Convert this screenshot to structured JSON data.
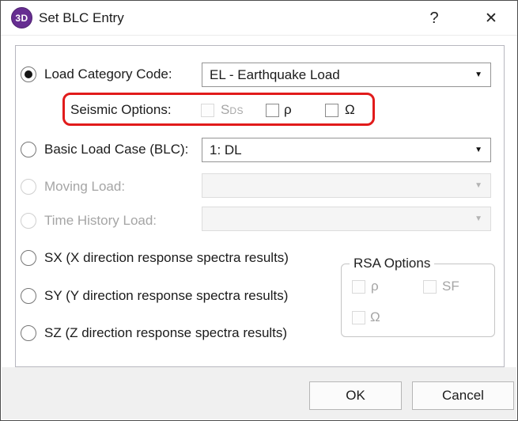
{
  "window": {
    "title": "Set BLC Entry",
    "icon": "3D",
    "help": "?",
    "close": "✕"
  },
  "colors": {
    "icon_purple": "#662d91",
    "highlight_red": "#e11b1b"
  },
  "load_category": {
    "label": "Load Category Code:",
    "value": "EL - Earthquake Load",
    "selected": true
  },
  "seismic": {
    "label": "Seismic Options:",
    "sds_main": "S",
    "sds_sub": "DS",
    "rho": "ρ",
    "omega": "Ω"
  },
  "basic_load_case": {
    "label": "Basic Load Case (BLC):",
    "value": "1: DL"
  },
  "moving_load": {
    "label": "Moving Load:",
    "value": ""
  },
  "time_history": {
    "label": "Time History Load:",
    "value": ""
  },
  "spectra": {
    "sx": "SX (X direction response spectra results)",
    "sy": "SY (Y direction response spectra results)",
    "sz": "SZ (Z direction response spectra results)"
  },
  "rsa": {
    "title": "RSA Options",
    "rho": "ρ",
    "sf": "SF",
    "omega": "Ω"
  },
  "footer": {
    "ok": "OK",
    "cancel": "Cancel"
  }
}
